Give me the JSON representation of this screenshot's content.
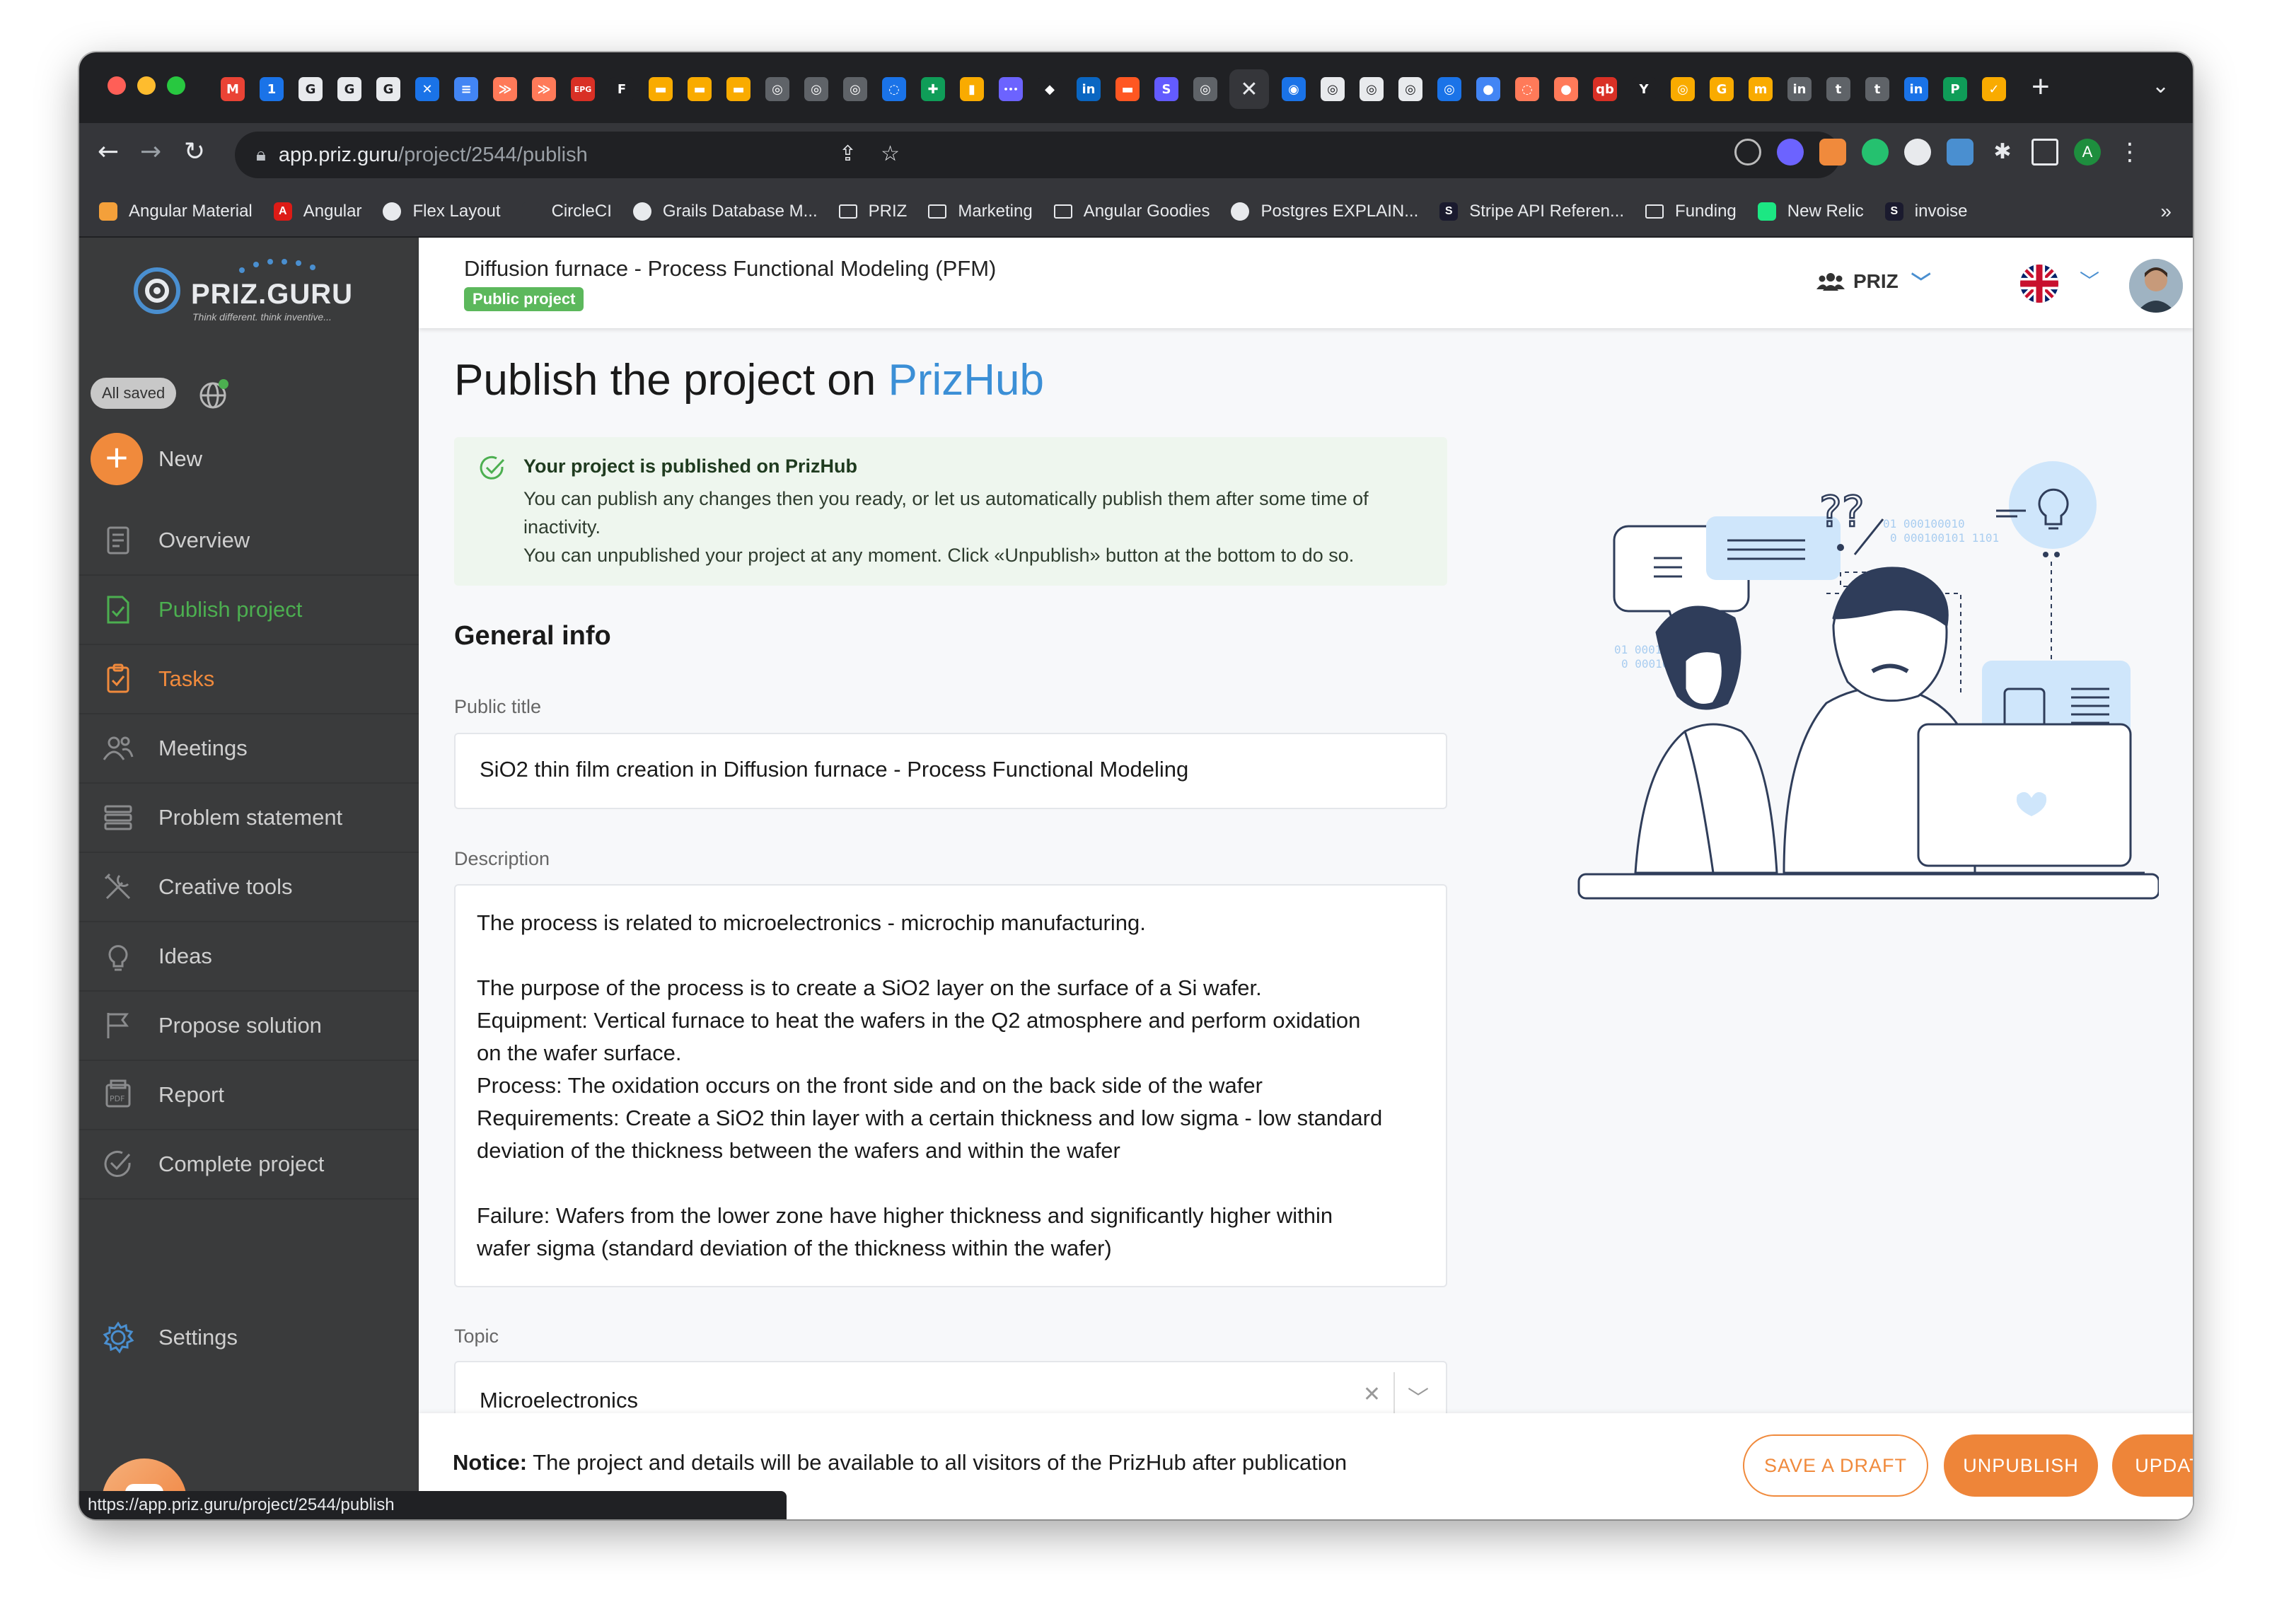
{
  "browser": {
    "url_host": "app.priz.guru",
    "url_path": "/project/2544/publish",
    "status_url": "https://app.priz.guru/project/2544/publish",
    "bookmarks": [
      {
        "label": "Angular Material",
        "color": "#f4a03a",
        "glyph": ""
      },
      {
        "label": "Angular",
        "color": "#dd1b16",
        "glyph": "A"
      },
      {
        "label": "Flex Layout",
        "color": "#e8eaed",
        "glyph": ""
      },
      {
        "label": "CircleCI",
        "color": "#35363a",
        "glyph": ""
      },
      {
        "label": "Grails Database M...",
        "color": "#e8eaed",
        "glyph": ""
      },
      {
        "label": "PRIZ",
        "color": "folder",
        "glyph": ""
      },
      {
        "label": "Marketing",
        "color": "folder",
        "glyph": ""
      },
      {
        "label": "Angular Goodies",
        "color": "folder",
        "glyph": ""
      },
      {
        "label": "Postgres EXPLAIN...",
        "color": "#e8eaed",
        "glyph": ""
      },
      {
        "label": "Stripe API Referen...",
        "color": "#1a1a2e",
        "glyph": "S"
      },
      {
        "label": "Funding",
        "color": "folder",
        "glyph": ""
      },
      {
        "label": "New Relic",
        "color": "#1ce783",
        "glyph": ""
      },
      {
        "label": "invoise",
        "color": "#1a1a2e",
        "glyph": "S"
      }
    ],
    "tab_glyphs": [
      "M",
      "1",
      "G",
      "G",
      "G",
      "✕",
      "≡",
      "≫",
      "≫",
      "EPG",
      "F",
      "▬",
      "▬",
      "▬",
      "◎",
      "◎",
      "◎",
      "◌",
      "✚",
      "▮",
      "•••",
      "◆",
      "in",
      "▬",
      "S",
      "◎",
      "✕",
      "◉",
      "◎",
      "◎",
      "◎",
      "◎",
      "●",
      "◌",
      "●",
      "qb",
      "Y",
      "◎",
      "G",
      "m",
      "in",
      "t",
      "t",
      "in",
      "P",
      "✓"
    ],
    "profile_initial": "A"
  },
  "sidebar": {
    "logo_text": "PRIZ.GURU",
    "logo_tagline": "Think different. think inventive...",
    "saved_status": "All saved",
    "new_label": "New",
    "nav": [
      {
        "label": "Overview",
        "icon": "document-icon",
        "state": "normal"
      },
      {
        "label": "Publish project",
        "icon": "publish-icon",
        "state": "active"
      },
      {
        "label": "Tasks",
        "icon": "clipboard-icon",
        "state": "tasks"
      },
      {
        "label": "Meetings",
        "icon": "people-icon",
        "state": "normal"
      },
      {
        "label": "Problem statement",
        "icon": "stack-icon",
        "state": "normal"
      },
      {
        "label": "Creative tools",
        "icon": "tools-icon",
        "state": "normal"
      },
      {
        "label": "Ideas",
        "icon": "lightbulb-icon",
        "state": "normal"
      },
      {
        "label": "Propose solution",
        "icon": "flag-icon",
        "state": "normal"
      },
      {
        "label": "Report",
        "icon": "pdf-icon",
        "state": "normal"
      },
      {
        "label": "Complete project",
        "icon": "check-circle-icon",
        "state": "normal"
      }
    ],
    "settings_label": "Settings"
  },
  "header": {
    "project_title": "Diffusion furnace - Process Functional Modeling (PFM)",
    "badge": "Public project",
    "team": "PRIZ"
  },
  "page": {
    "heading_prefix": "Publish the project on ",
    "heading_accent": "PrizHub",
    "alert": {
      "title": "Your project is published on PrizHub",
      "lines": [
        "You can publish any changes then you ready, or let us automatically publish them after some time of",
        "inactivity.",
        "You can unpublished your project at any moment. Click «Unpublish» button at the bottom to do so."
      ]
    },
    "general_info": "General info",
    "public_title_label": "Public title",
    "public_title_value": "SiO2 thin film creation in Diffusion furnace - Process Functional Modeling",
    "description_label": "Description",
    "description_lines": [
      "The process is related to microelectronics - microchip manufacturing.",
      "",
      "The purpose of the process is to create a SiO2 layer on the surface of a Si wafer.",
      "Equipment: Vertical furnace to heat the wafers in the Q2 atmosphere and perform oxidation",
      "on the wafer surface.",
      "Process: The oxidation occurs on the front side and on the back side of the wafer",
      "Requirements: Create a SiO2 thin layer with a certain thickness and low sigma - low standard",
      "deviation of the thickness between the wafers and within the wafer",
      "",
      "Failure: Wafers from the lower zone have higher thickness and significantly higher within",
      "wafer sigma (standard deviation of the thickness within the wafer)"
    ],
    "topic_label": "Topic",
    "topic_value": "Microelectronics",
    "illustration_binary": [
      "01   000100010",
      "0  000100101  1101"
    ]
  },
  "footer": {
    "notice_bold": "Notice:",
    "notice_text": " The project and details will be available to all visitors of the PrizHub after publication",
    "save_draft": "SAVE A DRAFT",
    "unpublish": "UNPUBLISH",
    "update": "UPDATE"
  },
  "colors": {
    "accent_orange": "#ee8539",
    "accent_blue": "#3b8fd6",
    "active_green": "#4caf50",
    "sidebar_bg": "#3a3b3c"
  }
}
